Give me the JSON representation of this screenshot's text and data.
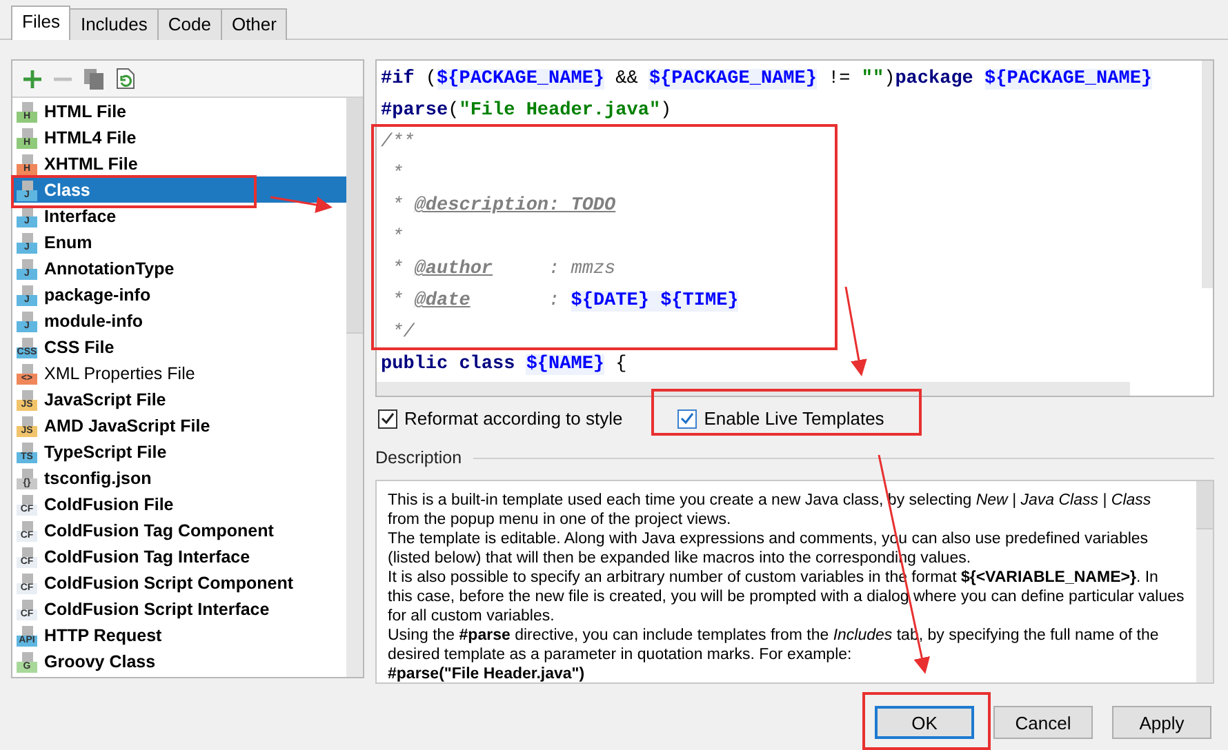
{
  "tabs": [
    {
      "label": "Files",
      "selected": true
    },
    {
      "label": "Includes",
      "selected": false
    },
    {
      "label": "Code",
      "selected": false
    },
    {
      "label": "Other",
      "selected": false
    }
  ],
  "toolbar": [
    {
      "kind": "add",
      "disabled": false
    },
    {
      "kind": "remove",
      "disabled": true
    },
    {
      "kind": "copy",
      "disabled": false
    },
    {
      "kind": "reset",
      "disabled": false
    }
  ],
  "templates": [
    {
      "name": "HTML File",
      "badge": "H",
      "color": "#8fc97a",
      "bold": true,
      "selected": false
    },
    {
      "name": "HTML4 File",
      "badge": "H",
      "color": "#8fc97a",
      "bold": true,
      "selected": false
    },
    {
      "name": "XHTML File",
      "badge": "H",
      "color": "#f0875a",
      "bold": true,
      "selected": false
    },
    {
      "name": "Class",
      "badge": "J",
      "color": "#5fb6e0",
      "bold": true,
      "selected": true
    },
    {
      "name": "Interface",
      "badge": "J",
      "color": "#5fb6e0",
      "bold": true,
      "selected": false
    },
    {
      "name": "Enum",
      "badge": "J",
      "color": "#5fb6e0",
      "bold": true,
      "selected": false
    },
    {
      "name": "AnnotationType",
      "badge": "J",
      "color": "#5fb6e0",
      "bold": true,
      "selected": false
    },
    {
      "name": "package-info",
      "badge": "J",
      "color": "#5fb6e0",
      "bold": true,
      "selected": false
    },
    {
      "name": "module-info",
      "badge": "J",
      "color": "#5fb6e0",
      "bold": true,
      "selected": false
    },
    {
      "name": "CSS File",
      "badge": "CSS",
      "color": "#5fb6e0",
      "bold": true,
      "selected": false
    },
    {
      "name": "XML Properties File",
      "badge": "<>",
      "color": "#f0875a",
      "bold": false,
      "selected": false
    },
    {
      "name": "JavaScript File",
      "badge": "JS",
      "color": "#f2c46a",
      "bold": true,
      "selected": false
    },
    {
      "name": "AMD JavaScript File",
      "badge": "JS",
      "color": "#f2c46a",
      "bold": true,
      "selected": false
    },
    {
      "name": "TypeScript File",
      "badge": "TS",
      "color": "#5fb6e0",
      "bold": true,
      "selected": false
    },
    {
      "name": "tsconfig.json",
      "badge": "{}",
      "color": "#c8c8c8",
      "bold": true,
      "selected": false
    },
    {
      "name": "ColdFusion File",
      "badge": "CF",
      "color": "#e8eef4",
      "bold": true,
      "selected": false
    },
    {
      "name": "ColdFusion Tag Component",
      "badge": "CF",
      "color": "#e8eef4",
      "bold": true,
      "selected": false
    },
    {
      "name": "ColdFusion Tag Interface",
      "badge": "CF",
      "color": "#e8eef4",
      "bold": true,
      "selected": false
    },
    {
      "name": "ColdFusion Script Component",
      "badge": "CF",
      "color": "#e8eef4",
      "bold": true,
      "selected": false
    },
    {
      "name": "ColdFusion Script Interface",
      "badge": "CF",
      "color": "#e8eef4",
      "bold": true,
      "selected": false
    },
    {
      "name": "HTTP Request",
      "badge": "API",
      "color": "#5fb6e0",
      "bold": true,
      "selected": false
    },
    {
      "name": "Groovy Class",
      "badge": "G",
      "color": "#a8d89a",
      "bold": true,
      "selected": false
    }
  ],
  "code_lines": [
    [
      {
        "t": "#if",
        "kind": "directive"
      },
      {
        "t": " (",
        "kind": "plain"
      },
      {
        "t": "${PACKAGE_NAME}",
        "kind": "var"
      },
      {
        "t": " && ",
        "kind": "plain"
      },
      {
        "t": "${PACKAGE_NAME}",
        "kind": "var"
      },
      {
        "t": " != ",
        "kind": "plain"
      },
      {
        "t": "\"\"",
        "kind": "string"
      },
      {
        "t": ")",
        "kind": "plain"
      },
      {
        "t": "package ",
        "kind": "keyword"
      },
      {
        "t": "${PACKAGE_NAME}",
        "kind": "var"
      }
    ],
    [
      {
        "t": "#parse",
        "kind": "directive"
      },
      {
        "t": "(",
        "kind": "plain"
      },
      {
        "t": "\"File Header.java\"",
        "kind": "string"
      },
      {
        "t": ")",
        "kind": "plain"
      }
    ],
    [
      {
        "t": "/**",
        "kind": "comment"
      }
    ],
    [
      {
        "t": " *",
        "kind": "comment"
      }
    ],
    [
      {
        "t": " * ",
        "kind": "comment"
      },
      {
        "t": "@description: TODO",
        "kind": "tag"
      }
    ],
    [
      {
        "t": " *",
        "kind": "comment"
      }
    ],
    [
      {
        "t": " * ",
        "kind": "comment"
      },
      {
        "t": "@author",
        "kind": "tag"
      },
      {
        "t": "     : mmzs",
        "kind": "comment"
      }
    ],
    [
      {
        "t": " * ",
        "kind": "comment"
      },
      {
        "t": "@date",
        "kind": "tag"
      },
      {
        "t": "       : ",
        "kind": "comment"
      },
      {
        "t": "${DATE} ",
        "kind": "var"
      },
      {
        "t": "${TIME}",
        "kind": "var"
      }
    ],
    [
      {
        "t": " */",
        "kind": "comment"
      }
    ],
    [
      {
        "t": "public class ",
        "kind": "keyword"
      },
      {
        "t": "${NAME}",
        "kind": "var"
      },
      {
        "t": " {",
        "kind": "plain"
      }
    ]
  ],
  "options": [
    {
      "label": "Reformat according to style",
      "checked": true
    },
    {
      "label": "Enable Live Templates",
      "checked": true
    }
  ],
  "description": {
    "title": "Description",
    "paragraphs": [
      {
        "kind": "text",
        "text": "This is a built-in template used each time you create a new Java class, by selecting *New* | *Java Class* | *Class* from the popup menu in one of the project views."
      },
      {
        "kind": "text",
        "text": "The template is editable. Along with Java expressions and comments, you can also use predefined variables (listed below) that will then be expanded like macros into the corresponding values."
      },
      {
        "kind": "text",
        "text": "It is also possible to specify an arbitrary number of custom variables in the format **${<VARIABLE_NAME>}**. In this case, before the new file is created, you will be prompted with a dialog where you can define particular values for all custom variables."
      },
      {
        "kind": "text",
        "text": "Using the **#parse** directive, you can include templates from the *Includes* tab, by specifying the full name of the desired template as a parameter in quotation marks. For example:"
      },
      {
        "kind": "code",
        "text": "#parse(\"File Header.java\")"
      }
    ]
  },
  "buttons": [
    {
      "label": "OK",
      "default": true
    },
    {
      "label": "Cancel",
      "default": false
    },
    {
      "label": "Apply",
      "default": false
    }
  ]
}
